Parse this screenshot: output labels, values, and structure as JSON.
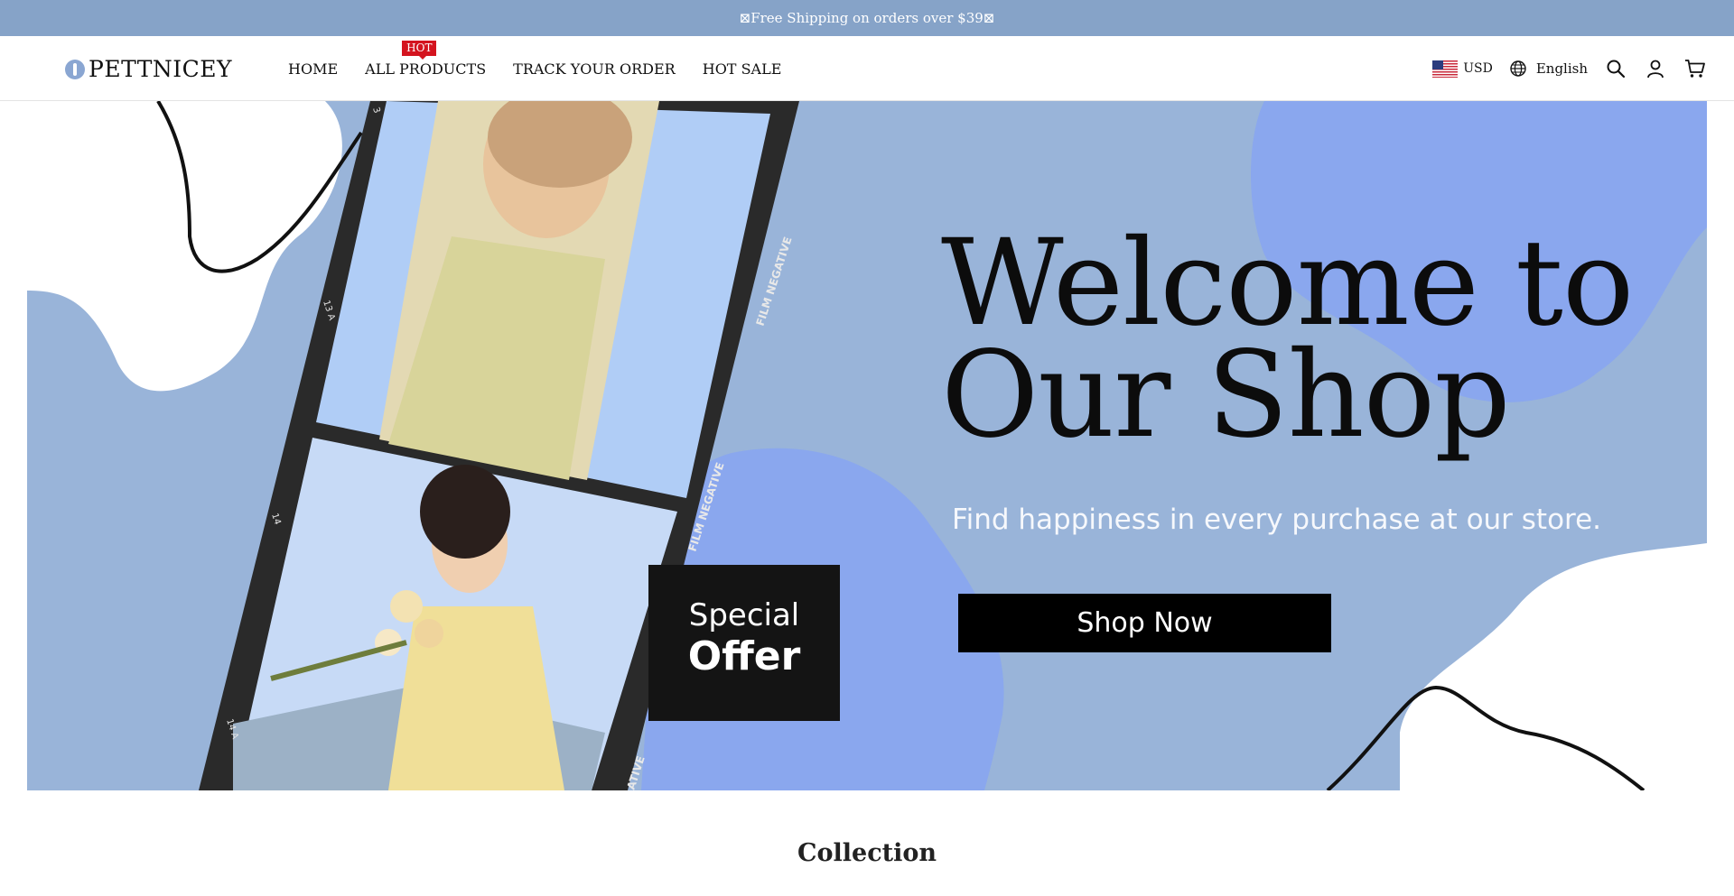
{
  "announcement": {
    "text": "⊠Free Shipping on orders over $39⊠"
  },
  "header": {
    "logo_text": "PETTNICEY",
    "nav": [
      {
        "label": "HOME"
      },
      {
        "label": "ALL PRODUCTS",
        "badge": "HOT"
      },
      {
        "label": "TRACK YOUR ORDER"
      },
      {
        "label": "HOT SALE"
      }
    ],
    "currency": "USD",
    "language": "English",
    "icons": [
      "flag-us-icon",
      "globe-icon",
      "search-icon",
      "user-icon",
      "cart-icon"
    ]
  },
  "hero": {
    "headline_line1": "Welcome to",
    "headline_line2": "Our Shop",
    "subtitle": "Find happiness in every purchase at our store.",
    "cta_label": "Shop Now",
    "offer_line1": "Special",
    "offer_line2": "Offer",
    "film_labels": [
      "3",
      "13 A",
      "14",
      "14 A",
      "FILM NEGATIVE",
      "FILM NEGATIVE",
      "ATIVE"
    ],
    "colors": {
      "background": "#99b4d9",
      "blob": "#8aa7ee",
      "film": "#2a2a2a"
    }
  },
  "collection_title": "Collection"
}
